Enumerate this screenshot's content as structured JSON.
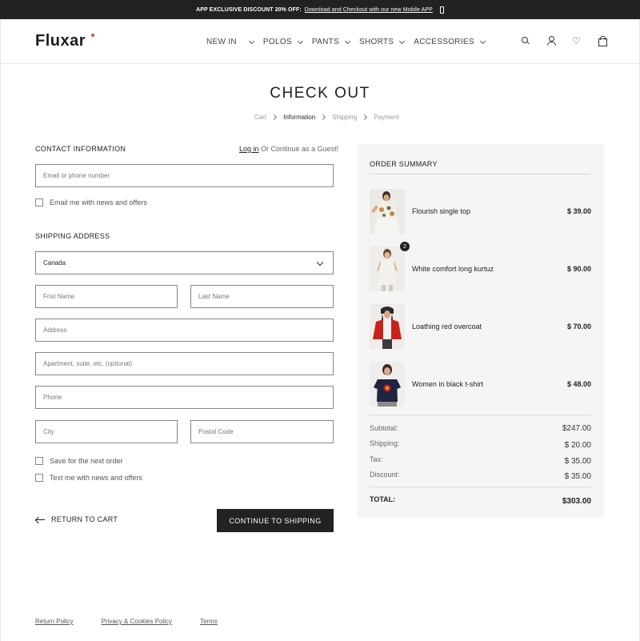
{
  "topbar": {
    "promo": "APP EXCLUSIVE DISCOUNT 20% OFF:",
    "link": "Download and Checkout with our new Mobile APP",
    "icon": "phone-icon"
  },
  "header": {
    "logo": "Fluxar",
    "nav": [
      "NEW IN",
      "POLOS",
      "PANTS",
      "SHORTS",
      "ACCESSORIES"
    ],
    "icons": [
      "search-icon",
      "user-icon",
      "heart-icon",
      "bag-icon"
    ]
  },
  "page": {
    "title": "CHECK OUT",
    "breadcrumb": [
      "Cart",
      "Information",
      "Shipping",
      "Payment"
    ],
    "breadcrumb_active": "Information"
  },
  "contact": {
    "title": "CONTACT INFORMATION",
    "login_link": "Log in",
    "login_suffix": " Or Continue as a Guest!",
    "email_placeholder": "Email or phone number",
    "newsletter_label": "Email me with news and offers"
  },
  "shipping": {
    "title": "SHIPPING ADDRESS",
    "country": "Canada",
    "first_name_placeholder": "Frist Name",
    "last_name_placeholder": "Last Name",
    "address_placeholder": "Address",
    "apartment_placeholder": "Apartment, suite, etc. (optional)",
    "phone_placeholder": "Phone",
    "city_placeholder": "City",
    "postal_placeholder": "Postal Code",
    "save_label": "Save for the next order",
    "text_label": "Text me with news and offers"
  },
  "actions": {
    "return": "RETURN TO CART",
    "continue": "CONTINUE TO SHIPPING"
  },
  "summary": {
    "title": "ORDER SUMMARY",
    "items": [
      {
        "name": "Flourish single top",
        "price": "$ 39.00",
        "qty": ""
      },
      {
        "name": "White comfort long kurtuz",
        "price": "$ 90.00",
        "qty": "2"
      },
      {
        "name": "Loathing red overcoat",
        "price": "$ 70.00",
        "qty": ""
      },
      {
        "name": "Women in black t-shirt",
        "price": "$ 48.00",
        "qty": ""
      }
    ],
    "subtotal_label": "Subtotal:",
    "subtotal": "$247.00",
    "shipping_label": "Shipping:",
    "shipping": "$ 20.00",
    "tax_label": "Tax:",
    "tax": "$ 35.00",
    "discount_label": "Discount:",
    "discount": "$ 35.00",
    "total_label": "TOTAL:",
    "total": "$303.00"
  },
  "footer": {
    "links": [
      "Return Policy",
      "Privacy & Cookies Policy",
      "Terms"
    ]
  },
  "colors": {
    "dark": "#222222",
    "summary_bg": "#f5f5f5",
    "logo_accent": "#e24a2f",
    "coat_red": "#c8201a"
  }
}
